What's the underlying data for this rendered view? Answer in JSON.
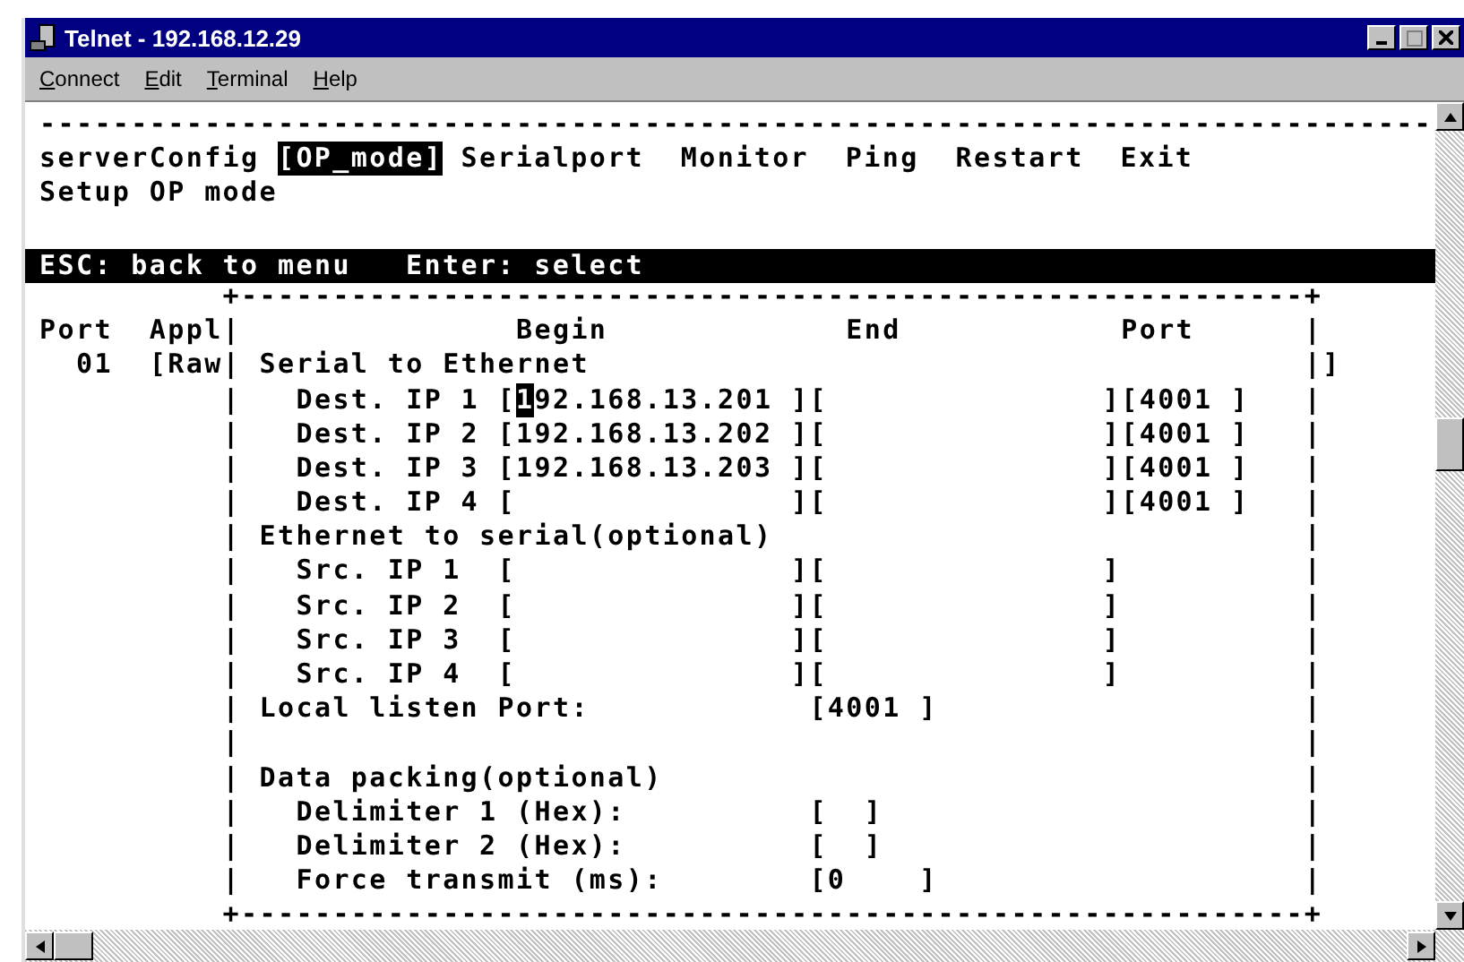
{
  "window": {
    "title": "Telnet - 192.168.12.29"
  },
  "menu": [
    {
      "label": "Connect"
    },
    {
      "label": "Edit"
    },
    {
      "label": "Terminal"
    },
    {
      "label": "Help"
    }
  ],
  "terminal": {
    "rule": "----------------------------------------------------------------------------",
    "menu_items": [
      {
        "label": "serverConfig",
        "selected": false
      },
      {
        "label": "[OP_mode]",
        "selected": true
      },
      {
        "label": "Serialport",
        "selected": false
      },
      {
        "label": "Monitor",
        "selected": false
      },
      {
        "label": "Ping",
        "selected": false
      },
      {
        "label": "Restart",
        "selected": false
      },
      {
        "label": "Exit",
        "selected": false
      }
    ],
    "description": "Setup OP mode",
    "hints": [
      "ESC: back to menu",
      "Enter: select"
    ],
    "lines": [
      {
        "text": "          +----------------------------------------------------------+"
      },
      {
        "text": "Port  Appl|               Begin             End            Port      |"
      },
      {
        "text": "  01  [Raw| Serial to Ethernet                                       |]"
      },
      {
        "text": "          |   Dest. IP 1 [",
        "cursor": "1",
        "after": "92.168.13.201 ][               ][4001 ]   |"
      },
      {
        "text": "          |   Dest. IP 2 [192.168.13.202 ][               ][4001 ]   |"
      },
      {
        "text": "          |   Dest. IP 3 [192.168.13.203 ][               ][4001 ]   |"
      },
      {
        "text": "          |   Dest. IP 4 [               ][               ][4001 ]   |"
      },
      {
        "text": "          | Ethernet to serial(optional)                             |"
      },
      {
        "text": "          |   Src. IP 1  [               ][               ]          |"
      },
      {
        "text": "          |   Src. IP 2  [               ][               ]          |"
      },
      {
        "text": "          |   Src. IP 3  [               ][               ]          |"
      },
      {
        "text": "          |   Src. IP 4  [               ][               ]          |"
      },
      {
        "text": "          | Local listen Port:            [4001 ]                    |"
      },
      {
        "text": "          |                                                          |"
      },
      {
        "text": "          | Data packing(optional)                                   |"
      },
      {
        "text": "          |   Delimiter 1 (Hex):          [  ]                       |"
      },
      {
        "text": "          |   Delimiter 2 (Hex):          [  ]                       |"
      },
      {
        "text": "          |   Force transmit (ms):        [0    ]                    |"
      },
      {
        "text": "          +----------------------------------------------------------+"
      }
    ]
  }
}
